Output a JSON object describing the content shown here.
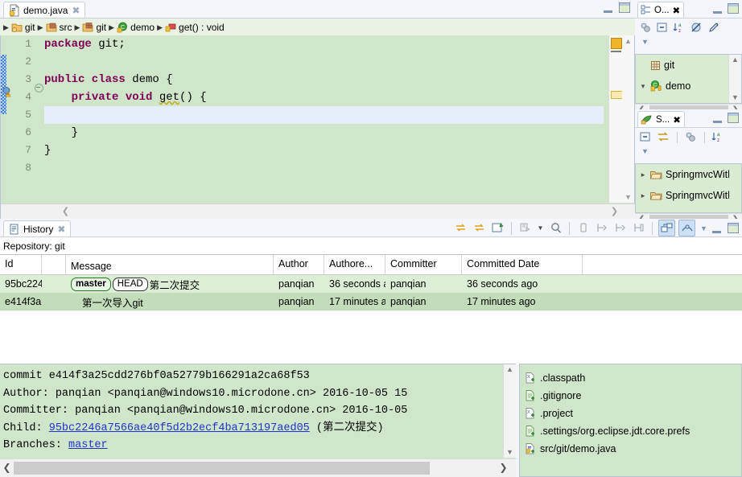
{
  "editor": {
    "tab_label": "demo.java",
    "tab_icon": "java-file-icon",
    "breadcrumb": [
      {
        "label": "git",
        "icon": "java-project-icon"
      },
      {
        "label": "src",
        "icon": "source-folder-icon"
      },
      {
        "label": "git",
        "icon": "package-icon"
      },
      {
        "label": "demo",
        "icon": "class-icon"
      },
      {
        "label": "get() : void",
        "icon": "method-icon"
      }
    ],
    "line_numbers": [
      "1",
      "2",
      "3",
      "4",
      "5",
      "6",
      "7",
      "8"
    ],
    "code_lines": [
      {
        "no": "1",
        "segments": [
          {
            "t": "package ",
            "k": "kw"
          },
          {
            "t": "git;",
            "k": "plain"
          }
        ]
      },
      {
        "no": "2",
        "segments": []
      },
      {
        "no": "3",
        "segments": [
          {
            "t": "public class ",
            "k": "kw"
          },
          {
            "t": "demo {",
            "k": "plain"
          }
        ]
      },
      {
        "no": "4",
        "segments": [
          {
            "t": "    ",
            "k": "plain"
          },
          {
            "t": "private void ",
            "k": "kw"
          },
          {
            "t": "get() {",
            "k": "plain"
          }
        ]
      },
      {
        "no": "5",
        "segments": []
      },
      {
        "no": "6",
        "segments": [
          {
            "t": "    }",
            "k": "plain"
          }
        ]
      },
      {
        "no": "7",
        "segments": [
          {
            "t": "}",
            "k": "plain"
          }
        ]
      },
      {
        "no": "8",
        "segments": []
      }
    ],
    "current_line": 5
  },
  "outline": {
    "tab_label": "O...",
    "tab_icon": "outline-icon",
    "toolbar": [
      "hide-fields-icon",
      "collapse-all-icon",
      "sort-icon",
      "hide-static-icon",
      "hide-nonpublic-icon"
    ],
    "menu_icon": "view-menu-icon",
    "items": [
      {
        "label": "git",
        "icon": "package-icon",
        "twisty": ""
      },
      {
        "label": "demo",
        "icon": "class-icon",
        "twisty": "v"
      }
    ]
  },
  "explorer": {
    "tab_label": "S...",
    "tab_icon": "package-explorer-icon",
    "toolbar": [
      "collapse-all-icon",
      "link-with-editor-icon",
      "hide-fields-icon",
      "sort-icon"
    ],
    "menu_icon": "view-menu-icon",
    "items": [
      {
        "label": "SpringmvcWitl",
        "icon": "folder-icon",
        "twisty": ">"
      },
      {
        "label": "SpringmvcWitl",
        "icon": "folder-icon",
        "twisty": ">"
      }
    ]
  },
  "history": {
    "tab_label": "History",
    "tab_icon": "history-icon",
    "repository_label": "Repository: git",
    "toolbar": [
      {
        "name": "refresh-icon",
        "active": false
      },
      {
        "name": "link-with-editor-icon",
        "active": false
      },
      {
        "name": "find-icon",
        "active": false
      },
      {
        "name": "compare-mode-icon",
        "active": false
      },
      {
        "name": "dropdown-arrow-icon",
        "active": false
      },
      {
        "name": "search-icon",
        "active": false
      },
      {
        "name": "show-all-branches-icon",
        "active": false
      },
      {
        "name": "filter-resource-icon",
        "active": false
      },
      {
        "name": "filter-folder-icon",
        "active": false
      },
      {
        "name": "filter-project-icon",
        "active": false
      },
      {
        "name": "show-commit-detail-icon",
        "active": true
      },
      {
        "name": "show-revision-comment-icon",
        "active": true
      },
      {
        "name": "view-menu-icon",
        "active": false
      },
      {
        "name": "minimize-icon",
        "active": false
      },
      {
        "name": "maximize-icon",
        "active": false
      }
    ],
    "columns": [
      "Id",
      "",
      "Message",
      "Author",
      "Authore...",
      "Committer",
      "Committed Date"
    ],
    "rows": [
      {
        "id": "95bc224",
        "badges": [
          {
            "text": "master",
            "type": "branch"
          },
          {
            "text": "HEAD",
            "type": "head"
          }
        ],
        "message": "第二次提交",
        "author": "panqian",
        "authored_date": "36 seconds a",
        "committer": "panqian",
        "committed_date": "36 seconds ago",
        "selected": false
      },
      {
        "id": "e414f3a",
        "badges": [],
        "message": "第一次导入git",
        "author": "panqian",
        "authored_date": "17 minutes a",
        "committer": "panqian",
        "committed_date": "17 minutes ago",
        "selected": true
      }
    ]
  },
  "detail": {
    "commit_label": "commit",
    "commit_sha": "e414f3a25cdd276bf0a52779b166291a2ca68f53",
    "author_label": "Author:",
    "author_value": "panqian <panqian@windows10.microdone.cn> 2016-10-05 15",
    "committer_label": "Committer:",
    "committer_value": "panqian <panqian@windows10.microdone.cn> 2016-10-05",
    "child_label": "Child:",
    "child_sha": "95bc2246a7566ae40f5d2b2ecf4ba713197aed05",
    "child_note": "(第二次提交)",
    "branches_label": "Branches:",
    "branches_value": "master"
  },
  "files": [
    {
      "name": ".classpath",
      "icon": "xml-file-added-icon"
    },
    {
      "name": ".gitignore",
      "icon": "text-file-added-icon"
    },
    {
      "name": ".project",
      "icon": "xml-file-added-icon"
    },
    {
      "name": ".settings/org.eclipse.jdt.core.prefs",
      "icon": "text-file-added-icon"
    },
    {
      "name": "src/git/demo.java",
      "icon": "java-file-added-icon"
    }
  ],
  "colors": {
    "editor_bg": "#cfe6cb",
    "keyword": "#7f0055",
    "selected_row": "#c3ddba",
    "row": "#dceed6",
    "link": "#2233cc"
  }
}
